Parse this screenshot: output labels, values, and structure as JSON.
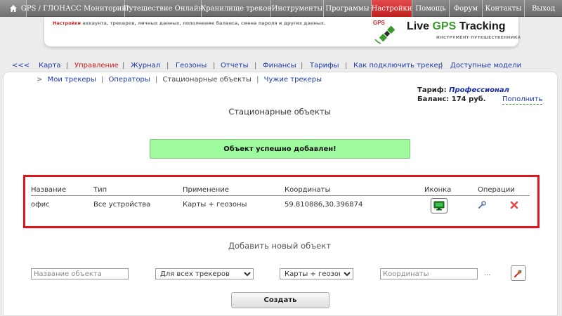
{
  "topnav": {
    "home_icon": "home-icon",
    "tabs": [
      {
        "label": "GPS / ГЛОНАСС Мониторинг",
        "active": false
      },
      {
        "label": "Путешествие Онлайн",
        "active": false
      },
      {
        "label": "Хранилище треков",
        "active": false
      },
      {
        "label": "Инструменты",
        "active": false
      },
      {
        "label": "Программы",
        "active": false
      },
      {
        "label": "Настройки",
        "active": true
      },
      {
        "label": "Помощь",
        "active": false
      },
      {
        "label": "Форум",
        "active": false
      },
      {
        "label": "Контакты",
        "active": false
      },
      {
        "label": "Выход",
        "active": false
      }
    ],
    "active_color": "#d32f2f"
  },
  "banner": {
    "desc_highlight": "Настройки",
    "desc_rest": " аккаунта, трекеров, личных данных, пополнение баланса, смена пароля и других данных.",
    "brand_part1": "Live ",
    "brand_part2": "GPS",
    "brand_part3": " Tracking",
    "tagline": "ИНСТРУМЕНТ ПУТЕШЕСТВЕННИКА",
    "logo_text": "GPS"
  },
  "subnav": {
    "back": "<<<",
    "items": [
      {
        "label": "Карта",
        "active": false
      },
      {
        "label": "Управление",
        "active": true
      },
      {
        "label": "Журнал",
        "active": false
      },
      {
        "label": "Геозоны",
        "active": false
      },
      {
        "label": "Отчеты",
        "active": false
      },
      {
        "label": "Финансы",
        "active": false
      },
      {
        "label": "Тарифы",
        "active": false
      },
      {
        "label": "Как подключить трекер",
        "active": false
      },
      {
        "label": "Доступные модели",
        "active": false
      }
    ],
    "separator": "|"
  },
  "crumbs": {
    "arrow": ">",
    "items": [
      {
        "label": "Мои трекеры",
        "current": false
      },
      {
        "label": "Операторы",
        "current": false
      },
      {
        "label": "Стационарные объекты",
        "current": true
      },
      {
        "label": "Чужие трекеры",
        "current": false
      }
    ]
  },
  "account": {
    "tariff_label": "Тариф:",
    "tariff_value": "Профессионал",
    "balance_label": "Баланс:",
    "balance_value": "174 руб.",
    "topup_label": "Пополнить"
  },
  "page_title": "Стационарные объекты",
  "alert": {
    "text": "Объект успешно добавлен!",
    "color": "#9dfb9d"
  },
  "table": {
    "headers": {
      "name": "Название",
      "type": "Тип",
      "usage": "Применение",
      "coords": "Координаты",
      "icon": "Иконка",
      "ops": "Операции"
    },
    "rows": [
      {
        "name": "офис",
        "type": "Все устройства",
        "usage": "Карты + геозоны",
        "coords": "59.810886,30.396874",
        "icon": "monitor-icon",
        "edit_icon": "wrench-icon",
        "delete_icon": "delete-x-icon"
      }
    ],
    "highlight_color": "#e0141c"
  },
  "add_form": {
    "title": "Добавить новый объект",
    "name_placeholder": "Название объекта",
    "trackers_value": "Для всех трекеров",
    "usage_value": "Карты + геозоны",
    "coords_placeholder": "Координаты",
    "dots": "...",
    "pick_icon": "map-pick-icon",
    "submit_label": "Создать"
  }
}
